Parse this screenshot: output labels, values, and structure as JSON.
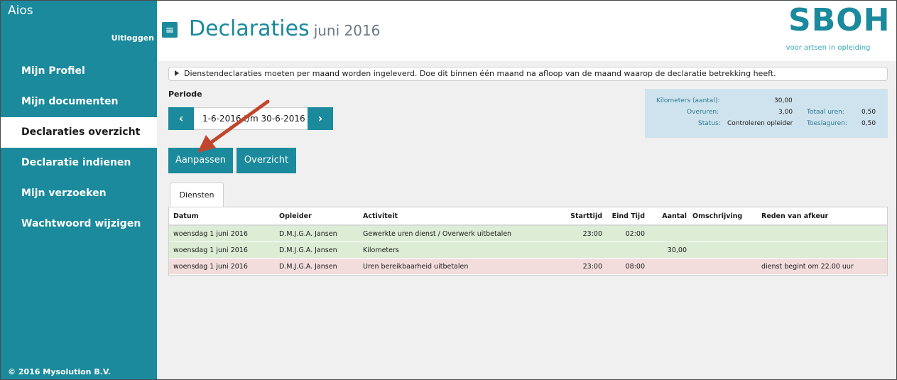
{
  "sidebar": {
    "brand": "Aios",
    "logout": "Uitloggen",
    "items": [
      {
        "label": "Mijn Profiel"
      },
      {
        "label": "Mijn documenten"
      },
      {
        "label": "Declaraties overzicht"
      },
      {
        "label": "Declaratie indienen"
      },
      {
        "label": "Mijn verzoeken"
      },
      {
        "label": "Wachtwoord wijzigen"
      }
    ],
    "active_index": 2,
    "copyright": "© 2016 Mysolution B.V."
  },
  "header": {
    "menu_icon": "≡",
    "title": "Declaraties",
    "subtitle": "juni 2016",
    "logo_text": "SBOH",
    "logo_tagline": "voor artsen in opleiding"
  },
  "notice": "Dienstendeclaraties moeten per maand worden ingeleverd. Doe dit binnen één maand na afloop van de maand waarop de declaratie betrekking heeft.",
  "period": {
    "label": "Periode",
    "prev_icon": "‹",
    "next_icon": "›",
    "range": "1-6-2016 t/m 30-6-2016"
  },
  "summary": {
    "kilometers_label": "Kilometers (aantal):",
    "kilometers_value": "30,00",
    "overuren_label": "Overuren:",
    "overuren_value": "3,00",
    "totaal_label": "Totaal uren:",
    "totaal_value": "0,50",
    "status_label": "Status:",
    "status_value": "Controleren opleider",
    "toeslag_label": "Toeslaguren:",
    "toeslag_value": "0,50"
  },
  "buttons": {
    "aanpassen": "Aanpassen",
    "overzicht": "Overzicht"
  },
  "tabs": [
    {
      "label": "Diensten"
    }
  ],
  "table": {
    "headers": {
      "datum": "Datum",
      "opleider": "Opleider",
      "activiteit": "Activiteit",
      "starttijd": "Starttijd",
      "eindtijd": "Eind Tijd",
      "aantal": "Aantal",
      "omschrijving": "Omschrijving",
      "reden": "Reden van afkeur"
    },
    "rows": [
      {
        "datum": "woensdag 1 juni 2016",
        "opleider": "D.M.J.G.A. Jansen",
        "activiteit": "Gewerkte uren dienst / Overwerk uitbetalen",
        "starttijd": "23:00",
        "eindtijd": "02:00",
        "aantal": "",
        "omschrijving": "",
        "reden": "",
        "status": "green"
      },
      {
        "datum": "woensdag 1 juni 2016",
        "opleider": "D.M.J.G.A. Jansen",
        "activiteit": "Kilometers",
        "starttijd": "",
        "eindtijd": "",
        "aantal": "30,00",
        "omschrijving": "",
        "reden": "",
        "status": "green"
      },
      {
        "datum": "woensdag 1 juni 2016",
        "opleider": "D.M.J.G.A. Jansen",
        "activiteit": "Uren bereikbaarheid uitbetalen",
        "starttijd": "23:00",
        "eindtijd": "08:00",
        "aantal": "",
        "omschrijving": "",
        "reden": "dienst begint om 22.00 uur",
        "status": "red"
      }
    ]
  },
  "colors": {
    "brand": "#1a8a9c",
    "row_ok": "#dcecd5",
    "row_rejected": "#f2dcdc",
    "annotation_arrow": "#c0472e"
  }
}
